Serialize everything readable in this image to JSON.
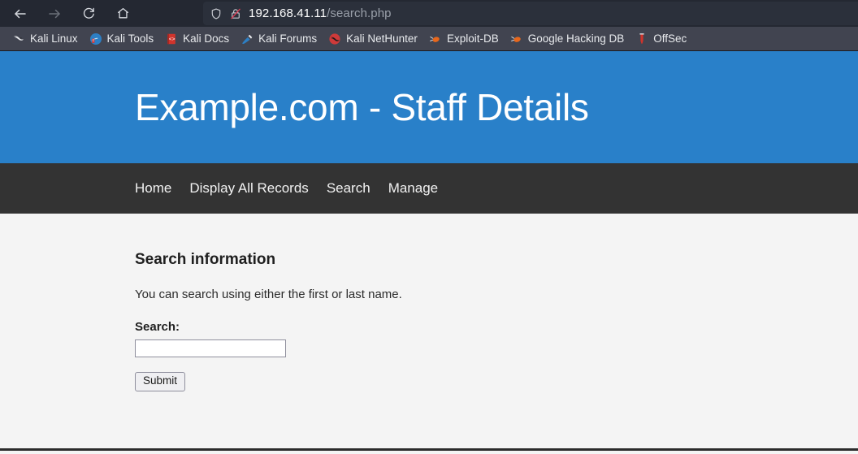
{
  "browser": {
    "toolbar_buttons": [
      {
        "name": "back-button",
        "icon": "arrow-left-icon",
        "state": "enabled"
      },
      {
        "name": "forward-button",
        "icon": "arrow-right-icon",
        "state": "disabled"
      },
      {
        "name": "reload-button",
        "icon": "reload-icon",
        "state": "enabled"
      },
      {
        "name": "home-button",
        "icon": "home-icon",
        "state": "enabled"
      }
    ],
    "urlbar": {
      "shield_icon": "shield-icon",
      "security_icon": "padlock-crossed-icon",
      "host": "192.168.41.11",
      "path": "/search.php",
      "full_url": "192.168.41.11/search.php"
    },
    "bookmarks": [
      {
        "label": "Kali Linux",
        "icon": "kali-dragon-icon"
      },
      {
        "label": "Kali Tools",
        "icon": "kali-tools-icon"
      },
      {
        "label": "Kali Docs",
        "icon": "kali-docs-icon"
      },
      {
        "label": "Kali Forums",
        "icon": "kali-forums-icon"
      },
      {
        "label": "Kali NetHunter",
        "icon": "kali-nethunter-icon"
      },
      {
        "label": "Exploit-DB",
        "icon": "exploit-db-icon"
      },
      {
        "label": "Google Hacking DB",
        "icon": "google-hacking-db-icon"
      },
      {
        "label": "OffSec",
        "icon": "offsec-icon"
      }
    ]
  },
  "page": {
    "header_title": "Example.com - Staff Details",
    "nav": [
      {
        "label": "Home"
      },
      {
        "label": "Display All Records"
      },
      {
        "label": "Search"
      },
      {
        "label": "Manage"
      }
    ],
    "main": {
      "heading": "Search information",
      "description": "You can search using either the first or last name.",
      "form": {
        "search_label": "Search:",
        "search_value": "",
        "search_placeholder": "",
        "submit_label": "Submit"
      }
    }
  },
  "colors": {
    "header_blue": "#2980c9",
    "nav_dark": "#333333",
    "page_background": "#f4f4f4",
    "chrome_toolbar": "#242832",
    "chrome_bookmarks": "#414450",
    "urlbar_background": "#2b303b"
  }
}
